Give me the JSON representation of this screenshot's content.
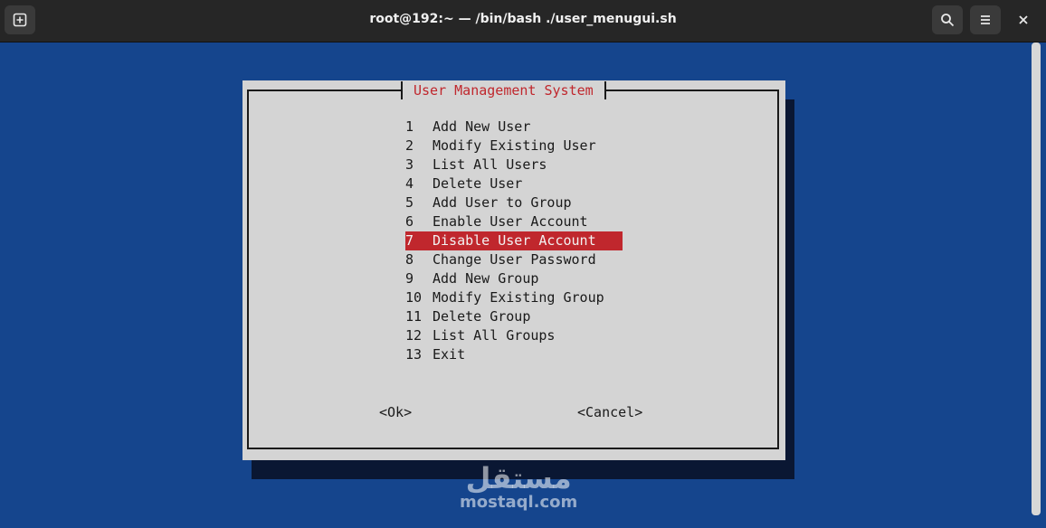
{
  "window": {
    "title": "root@192:~ — /bin/bash ./user_menugui.sh",
    "icons": {
      "new_tab": "new-tab-icon",
      "search": "search-icon",
      "menu": "hamburger-menu-icon",
      "close": "close-icon"
    }
  },
  "dialog": {
    "title": "User Management System",
    "items": [
      {
        "num": "1",
        "label": "Add New User"
      },
      {
        "num": "2",
        "label": "Modify Existing User"
      },
      {
        "num": "3",
        "label": "List All Users"
      },
      {
        "num": "4",
        "label": "Delete User"
      },
      {
        "num": "5",
        "label": "Add User to Group"
      },
      {
        "num": "6",
        "label": "Enable User Account"
      },
      {
        "num": "7",
        "label": "Disable User Account"
      },
      {
        "num": "8",
        "label": "Change User Password"
      },
      {
        "num": "9",
        "label": "Add New Group"
      },
      {
        "num": "10",
        "label": "Modify Existing Group"
      },
      {
        "num": "11",
        "label": "Delete Group"
      },
      {
        "num": "12",
        "label": "List All Groups"
      },
      {
        "num": "13",
        "label": "Exit"
      }
    ],
    "selected_index": 6,
    "ok_label": "<Ok>",
    "cancel_label": "<Cancel>"
  },
  "watermark": {
    "arabic": "مستقل",
    "latin": "mostaql.com"
  },
  "colors": {
    "terminal_bg": "#15458d",
    "dialog_bg": "#d4d4d4",
    "accent_red": "#c0272d",
    "titlebar_bg": "#262626"
  }
}
